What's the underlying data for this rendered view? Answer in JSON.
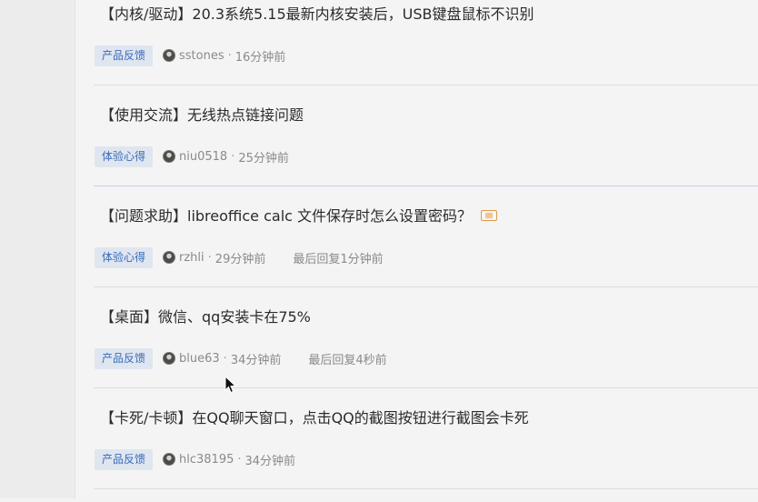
{
  "posts": [
    {
      "title": "【内核/驱动】20.3系统5.15最新内核安装后，USB键盘鼠标不识别",
      "tag": "产品反馈",
      "author": "sstones",
      "separator": "·",
      "time": "16分钟前",
      "last_reply": "",
      "has_image": false
    },
    {
      "title": "【使用交流】无线热点链接问题",
      "tag": "体验心得",
      "author": "niu0518",
      "separator": "·",
      "time": "25分钟前",
      "last_reply": "",
      "has_image": false
    },
    {
      "title": "【问题求助】libreoffice calc 文件保存时怎么设置密码？",
      "tag": "体验心得",
      "author": "rzhli",
      "separator": "·",
      "time": "29分钟前",
      "last_reply": "最后回复1分钟前",
      "has_image": true
    },
    {
      "title": "【桌面】微信、qq安装卡在75%",
      "tag": "产品反馈",
      "author": "blue63",
      "separator": "·",
      "time": "34分钟前",
      "last_reply": "最后回复4秒前",
      "has_image": false
    },
    {
      "title": "【卡死/卡顿】在QQ聊天窗口，点击QQ的截图按钮进行截图会卡死",
      "tag": "产品反馈",
      "author": "hlc38195",
      "separator": "·",
      "time": "34分钟前",
      "last_reply": "",
      "has_image": false
    }
  ],
  "colors": {
    "tag_bg": "#dfe6f0",
    "tag_text": "#3a6bb8",
    "meta_text": "#8a8a8a",
    "image_icon": "#e09a4a"
  },
  "icons": {
    "image_attachment": "image-icon",
    "avatar": "avatar",
    "cursor": "mouse-cursor-icon"
  }
}
